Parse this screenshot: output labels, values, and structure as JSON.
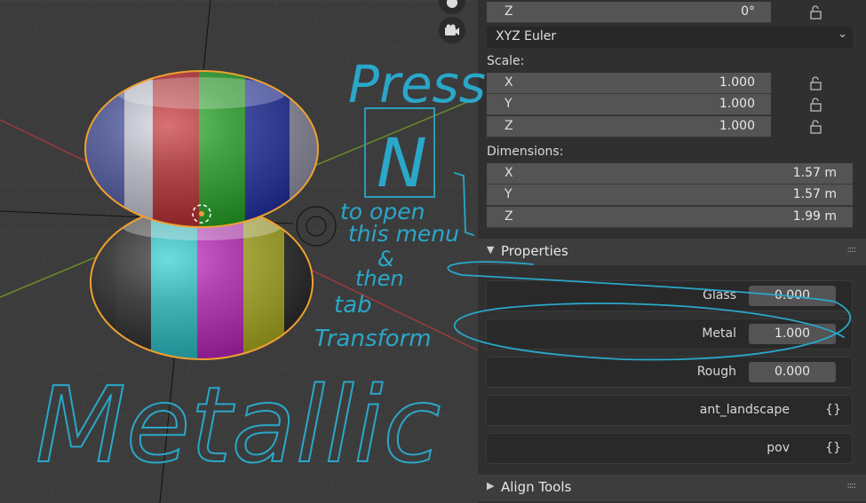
{
  "transform": {
    "rotation_z": {
      "axis": "Z",
      "value": "0°"
    },
    "rotation_mode": "XYZ Euler",
    "scale_label": "Scale:",
    "scale": [
      {
        "axis": "X",
        "value": "1.000"
      },
      {
        "axis": "Y",
        "value": "1.000"
      },
      {
        "axis": "Z",
        "value": "1.000"
      }
    ],
    "dimensions_label": "Dimensions:",
    "dimensions": [
      {
        "axis": "X",
        "value": "1.57 m"
      },
      {
        "axis": "Y",
        "value": "1.57 m"
      },
      {
        "axis": "Z",
        "value": "1.99 m"
      }
    ]
  },
  "properties": {
    "title": "Properties",
    "items": [
      {
        "label": "Glass",
        "value": "0.000"
      },
      {
        "label": "Metal",
        "value": "1.000"
      },
      {
        "label": "Rough",
        "value": "0.000"
      }
    ],
    "groups": [
      {
        "label": "ant_landscape",
        "value": "{}"
      },
      {
        "label": "pov",
        "value": "{}"
      }
    ]
  },
  "align_tools": {
    "title": "Align Tools"
  },
  "icons": [
    "camera-icon",
    "lock-icon",
    "chevron-down-icon",
    "collapse-arrow-icon",
    "expand-arrow-icon",
    "drag-grip-icon",
    "origin-marker-icon"
  ],
  "annotation": {
    "lines": [
      "Press",
      "N",
      "to open",
      "this menu",
      "&",
      "then",
      "tab",
      "Transform",
      "Metallic"
    ],
    "color": "#2aa7c9"
  },
  "colors": {
    "selection_outline": "#f0a030",
    "panel_bg": "#303030",
    "field_bg": "#545454"
  }
}
